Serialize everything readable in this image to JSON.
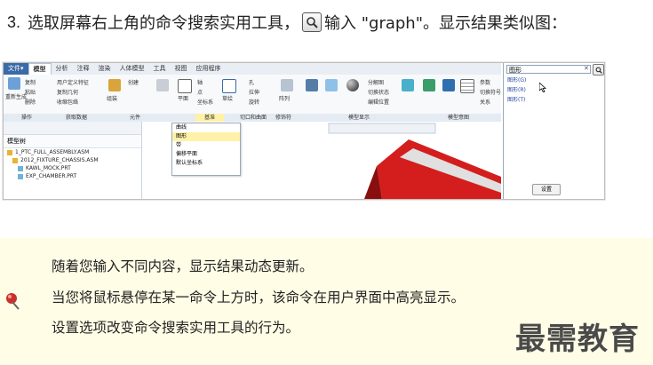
{
  "step": {
    "number": "3.",
    "before": "选取屏幕右上角的命令搜索实用工具，",
    "after": "输入 \"graph\"。显示结果类似图："
  },
  "screenshot": {
    "tabs": [
      "文件▾",
      "模型",
      "分析",
      "注释",
      "渲染",
      "人体模型",
      "工具",
      "视图",
      "应用程序"
    ],
    "ribbon_labels": [
      "重新生成",
      "复制",
      "粘贴",
      "删除",
      "用户定义特征",
      "复制几何",
      "收缩包络",
      "创建",
      "重命名",
      "组装",
      "拖动元件",
      "平面",
      "轴",
      "点",
      "坐标系",
      "草绘",
      "孔",
      "拉伸",
      "旋转",
      "阵列",
      "管理视图",
      "剖面",
      "外观库",
      "分解图",
      "切换状态",
      "编辑位置",
      "显示样式",
      "元件界面",
      "发布几何",
      "族表",
      "参数",
      "切换符号",
      "关系"
    ],
    "group_labels": [
      "操作",
      "获取数据",
      "元件",
      "基准",
      "切口和曲面",
      "修饰符",
      "模型显示",
      "模型意图"
    ],
    "model_tree": {
      "title": "模型树",
      "items": [
        "1_PTC_FULL_ASSEMBLY.ASM",
        "2012_FIXTURE_CHASSIS.ASM",
        "KAWL_MOCK.PRT",
        "EXP_CHAMBER.PRT"
      ]
    },
    "datum_menu": [
      "曲线",
      "图形",
      "带",
      "偏移平面",
      "默认坐标系"
    ],
    "search": {
      "query": "图形",
      "results": [
        "图形(G)",
        "图形(R)",
        "图形(T)"
      ],
      "settings_label": "设置"
    }
  },
  "notes": [
    "随着您输入不同内容，显示结果动态更新。",
    "当您将鼠标悬停在某一命令上方时，该命令在用户界面中高亮显示。",
    "设置选项改变命令搜索实用工具的行为。"
  ],
  "watermark": "最需教育",
  "colors": {
    "highlight": "#fff2a8",
    "note_bg": "#fffde6",
    "model_red": "#d41e1e"
  }
}
